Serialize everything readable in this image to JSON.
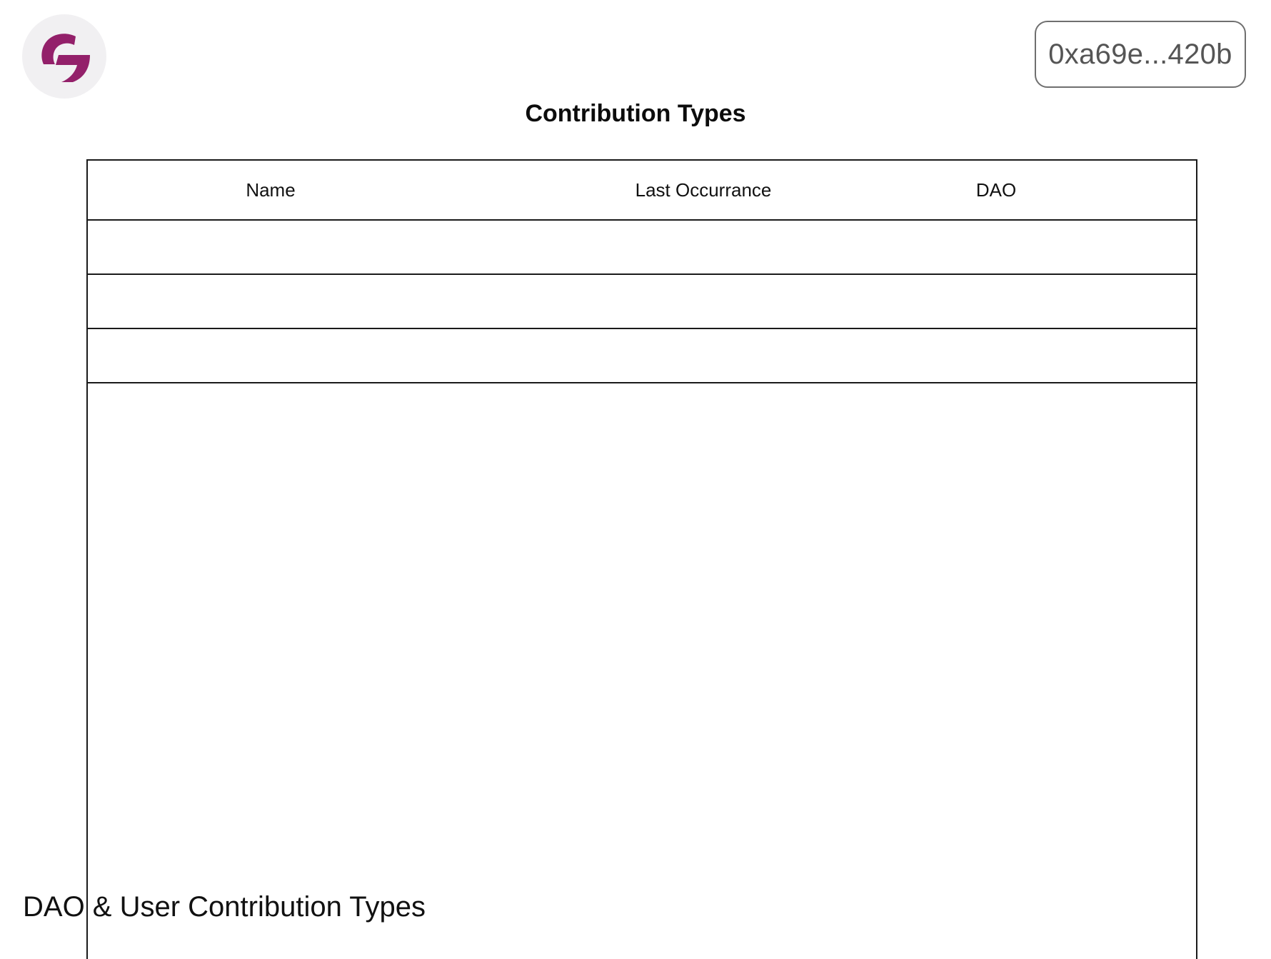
{
  "header": {
    "logo_icon": "g-logo-icon",
    "brand_color": "#93206a",
    "wallet_address": "0xa69e...420b"
  },
  "page": {
    "title": "Contribution Types"
  },
  "table": {
    "columns": [
      "Name",
      "Last Occurrance",
      "DAO"
    ],
    "rows": [
      {
        "name": "",
        "last_occurrance": "",
        "dao": ""
      },
      {
        "name": "",
        "last_occurrance": "",
        "dao": ""
      },
      {
        "name": "",
        "last_occurrance": "",
        "dao": ""
      }
    ]
  },
  "footer": {
    "title": "DAO & User Contribution Types"
  }
}
